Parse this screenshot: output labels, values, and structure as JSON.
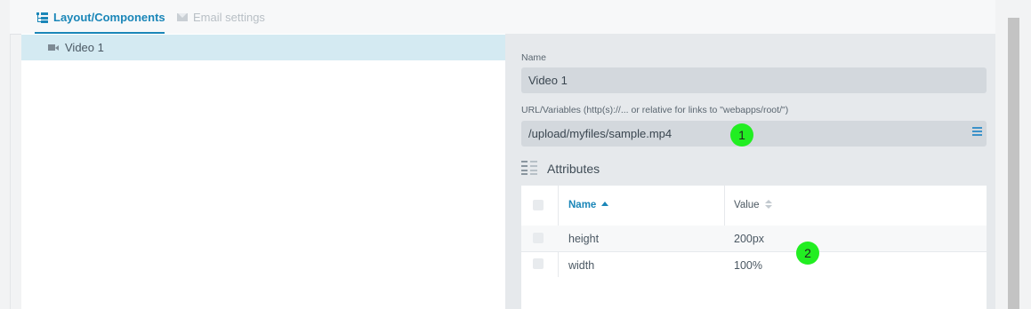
{
  "tabs": [
    {
      "label": "Layout/Components",
      "icon": "tree-icon",
      "active": true
    },
    {
      "label": "Email settings",
      "icon": "mail-icon",
      "active": false
    }
  ],
  "tree": {
    "items": [
      {
        "label": "Video 1",
        "icon": "video-camera-icon",
        "selected": true
      }
    ]
  },
  "form": {
    "name_label": "Name",
    "name_value": "Video 1",
    "url_label": "URL/Variables (http(s)://... or relative for links to \"webapps/root/\")",
    "url_value": "/upload/myfiles/sample.mp4",
    "url_button_icon": "list-icon"
  },
  "attributes": {
    "title": "Attributes",
    "icon": "attributes-list-icon",
    "columns": {
      "name": "Name",
      "value": "Value"
    },
    "rows": [
      {
        "name": "height",
        "value": "200px"
      },
      {
        "name": "width",
        "value": "100%"
      }
    ]
  },
  "markers": [
    "1",
    "2"
  ],
  "colors": {
    "accent": "#1a86b8",
    "selected_row": "#d4eaf2",
    "marker": "#22ee22"
  }
}
